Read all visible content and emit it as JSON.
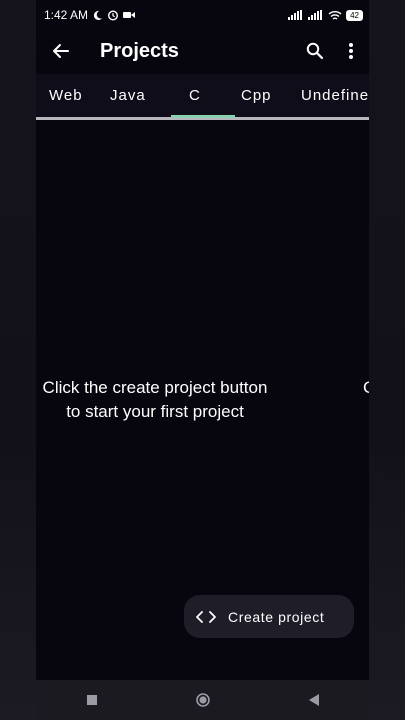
{
  "status": {
    "time": "1:42 AM",
    "battery": "42"
  },
  "app_bar": {
    "title": "Projects",
    "back_icon": "arrow-back-icon",
    "search_icon": "search-icon",
    "more_icon": "more-vert-icon"
  },
  "tabs": [
    {
      "label": "Web"
    },
    {
      "label": "Java"
    },
    {
      "label": "C",
      "selected": true
    },
    {
      "label": "Cpp"
    },
    {
      "label": "Undefine"
    }
  ],
  "empty_state": {
    "line1": "Click the create project button",
    "line2": "to start your first project",
    "peek": "C"
  },
  "fab": {
    "icon": "code-icon",
    "icon_glyph": "< >",
    "label": "Create project"
  },
  "colors": {
    "background": "#07050d",
    "tab_indicator": "#8bd3b0",
    "fab_background": "#1f1d27",
    "nav_bar": "#1b1a21"
  }
}
